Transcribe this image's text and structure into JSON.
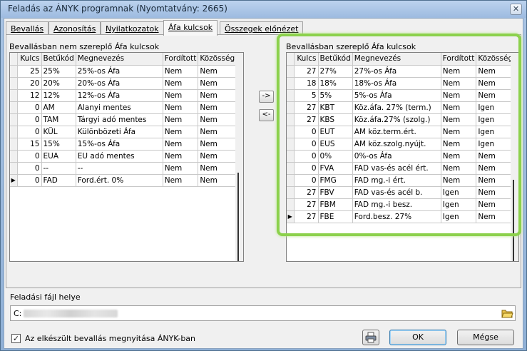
{
  "window": {
    "title": "Feladás az ÁNYK programnak (Nyomtatvány: 2665)",
    "close": "✕"
  },
  "tabs": [
    "Bevallás",
    "Azonosítás",
    "Nyilatkozatok",
    "Áfa kulcsok",
    "Összegek előnézet"
  ],
  "active_tab": "Áfa kulcsok",
  "left_panel": {
    "title": "Bevallásban nem szereplő Áfa kulcsok",
    "columns": [
      "Kulcs",
      "Betűkód",
      "Megnevezés",
      "Fordított",
      "Közösségi"
    ],
    "rows": [
      [
        "25",
        "25%",
        "25%-os Áfa",
        "Nem",
        "Nem"
      ],
      [
        "20",
        "20%",
        "20%-os Áfa",
        "Nem",
        "Nem"
      ],
      [
        "12",
        "12%",
        "12%-os Áfa",
        "Nem",
        "Nem"
      ],
      [
        "0",
        "AM",
        "Alanyi mentes",
        "Nem",
        "Nem"
      ],
      [
        "0",
        "TAM",
        "Tárgyi adó mentes",
        "Nem",
        "Nem"
      ],
      [
        "0",
        "KÜL",
        "Különbözeti Áfa",
        "Nem",
        "Nem"
      ],
      [
        "15",
        "15%",
        "15%-os Áfa",
        "Nem",
        "Nem"
      ],
      [
        "0",
        "EUA",
        "EU adó mentes",
        "Nem",
        "Nem"
      ],
      [
        "0",
        "--",
        "--",
        "Nem",
        "Nem"
      ],
      [
        "0",
        "FAD",
        "Ford.ért. 0%",
        "Nem",
        "Nem"
      ]
    ],
    "current_row": 9
  },
  "right_panel": {
    "title": "Bevallásban szereplő Áfa kulcsok",
    "columns": [
      "Kulcs",
      "Betűkód",
      "Megnevezés",
      "Fordított",
      "Közösségi"
    ],
    "rows": [
      [
        "27",
        "27%",
        "27%-os Áfa",
        "Nem",
        "Nem"
      ],
      [
        "18",
        "18%",
        "18%-os Áfa",
        "Nem",
        "Nem"
      ],
      [
        "5",
        "5%",
        "5%-os Áfa",
        "Nem",
        "Nem"
      ],
      [
        "27",
        "KBT",
        "Köz.áfa. 27% (term.)",
        "Nem",
        "Igen"
      ],
      [
        "27",
        "KBS",
        "Köz.áfa.27% (szolg.)",
        "Nem",
        "Igen"
      ],
      [
        "0",
        "EUT",
        "AM köz.term.ért.",
        "Nem",
        "Igen"
      ],
      [
        "0",
        "EUS",
        "AM köz.szolg.nyújt.",
        "Nem",
        "Igen"
      ],
      [
        "0",
        "0%",
        "0%-os Áfa",
        "Nem",
        "Nem"
      ],
      [
        "0",
        "FVA",
        "FAD vas-és acél ért.",
        "Nem",
        "Nem"
      ],
      [
        "0",
        "FMG",
        "FAD mg.-i ért.",
        "Nem",
        "Nem"
      ],
      [
        "27",
        "FBV",
        "FAD vas-és acél b.",
        "Igen",
        "Nem"
      ],
      [
        "27",
        "FBM",
        "FAD mg.-i besz.",
        "Igen",
        "Nem"
      ],
      [
        "27",
        "FBE",
        "Ford.besz. 27%",
        "Igen",
        "Nem"
      ]
    ],
    "current_row": 12
  },
  "move_buttons": {
    "right": "->",
    "left": "<-"
  },
  "path": {
    "label": "Feladási fájl helye",
    "value": "C:"
  },
  "footer": {
    "checkbox_label": "Az elkészült bevallás megnyitása ÁNYK-ban",
    "checkbox_checked": true,
    "ok": "OK",
    "cancel": "Mégse"
  }
}
